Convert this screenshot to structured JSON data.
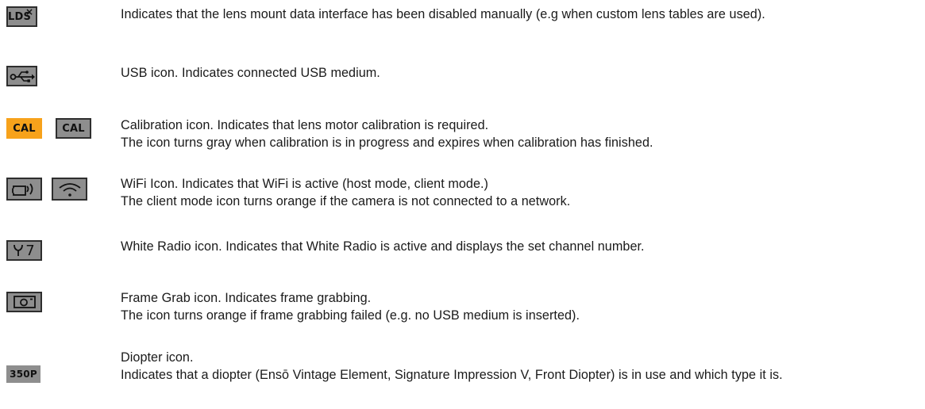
{
  "rows": [
    {
      "key": "lds",
      "icons": [
        {
          "name": "lds-disabled-icon",
          "label": "LDS",
          "badge": "×"
        }
      ],
      "lines": [
        "Indicates that the lens mount data interface has been disabled manually (e.g when custom lens tables are used)."
      ]
    },
    {
      "key": "usb",
      "icons": [
        {
          "name": "usb-icon"
        }
      ],
      "lines": [
        "USB icon. Indicates connected USB medium."
      ]
    },
    {
      "key": "cal",
      "icons": [
        {
          "name": "calibration-required-icon",
          "label": "CAL",
          "color": "#f7a21b"
        },
        {
          "name": "calibration-in-progress-icon",
          "label": "CAL",
          "color": "#8e8e8e"
        }
      ],
      "lines": [
        "Calibration icon. Indicates that lens motor calibration is required.",
        "The icon turns gray when calibration is in progress and expires when calibration has finished."
      ]
    },
    {
      "key": "wifi",
      "icons": [
        {
          "name": "wifi-host-mode-icon"
        },
        {
          "name": "wifi-client-mode-icon"
        }
      ],
      "lines": [
        "WiFi Icon. Indicates that WiFi is active (host mode, client mode.)",
        "The client mode icon turns orange if the camera is not connected to a network."
      ]
    },
    {
      "key": "white_radio",
      "icons": [
        {
          "name": "white-radio-icon",
          "label": "7"
        }
      ],
      "lines": [
        "White Radio icon. Indicates that White Radio is active and displays the set channel number."
      ]
    },
    {
      "key": "frame_grab",
      "icons": [
        {
          "name": "frame-grab-icon"
        }
      ],
      "lines": [
        "Frame Grab icon. Indicates frame grabbing.",
        "The icon turns orange if frame grabbing failed (e.g. no USB medium is inserted)."
      ]
    },
    {
      "key": "diopter",
      "icons": [
        {
          "name": "diopter-icon",
          "label": "350P"
        }
      ],
      "lines": [
        "Diopter icon.",
        "Indicates that a diopter (Ensō Vintage Element, Signature Impression V, Front Diopter) is in use and which type it is."
      ]
    }
  ]
}
